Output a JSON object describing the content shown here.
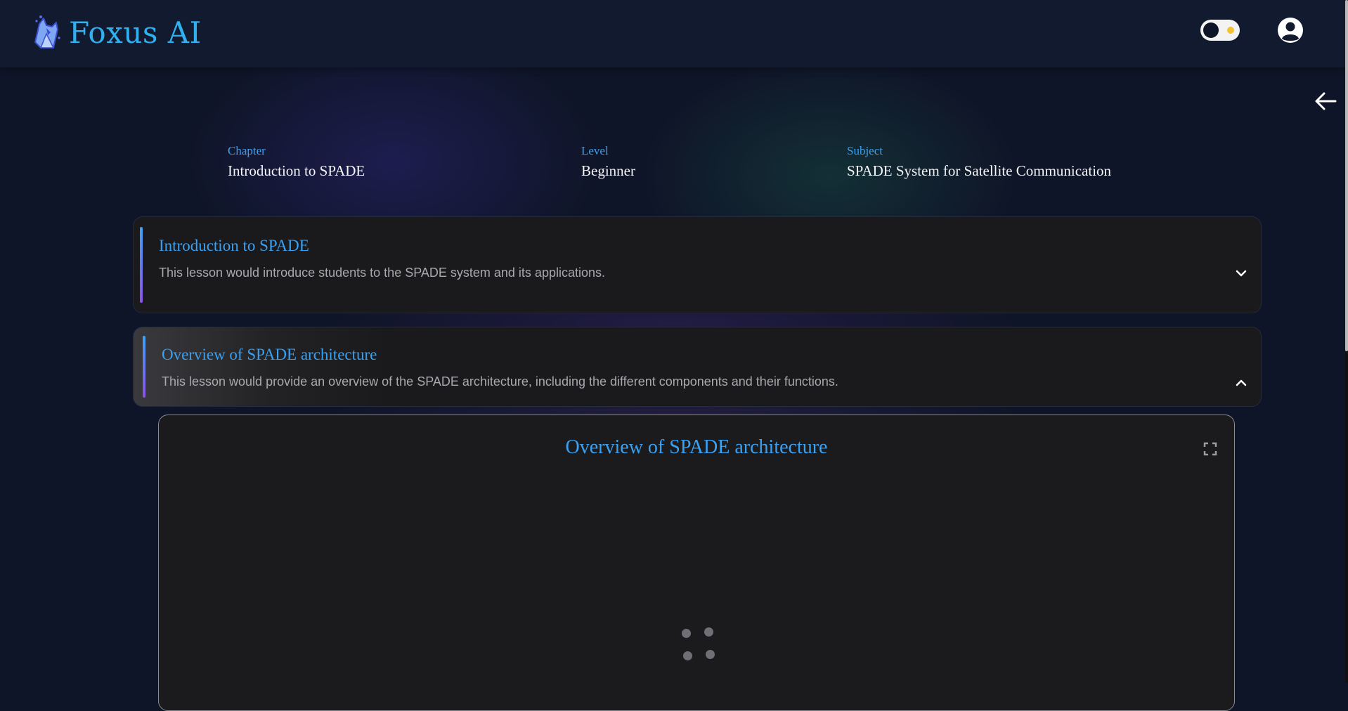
{
  "header": {
    "app_name": "Foxus AI",
    "logo_icon": "fox-logo-icon",
    "theme_toggle_icon": "theme-toggle-icon",
    "user_icon": "user-circle-icon"
  },
  "navigation": {
    "back_icon": "arrow-left-icon"
  },
  "meta": {
    "chapter_label": "Chapter",
    "chapter_value": "Introduction to SPADE",
    "level_label": "Level",
    "level_value": "Beginner",
    "subject_label": "Subject",
    "subject_value": "SPADE System for Satellite Communication"
  },
  "lessons": [
    {
      "title": "Introduction to SPADE",
      "description": "This lesson would introduce students to the SPADE system and its applications.",
      "expanded": false,
      "icon": "chevron-down-icon"
    },
    {
      "title": "Overview of SPADE architecture",
      "description": "This lesson would provide an overview of the SPADE architecture, including the different components and their functions.",
      "expanded": true,
      "icon": "chevron-up-icon"
    }
  ],
  "content_panel": {
    "title": "Overview of SPADE architecture",
    "fullscreen_icon": "fullscreen-icon",
    "loading_icon": "loading-spinner-icon"
  },
  "colors": {
    "background": "#0f1528",
    "header": "#121a30",
    "accent": "#3aa0f2",
    "card": "#1a1a1c",
    "muted_text": "#a7a9ae"
  }
}
